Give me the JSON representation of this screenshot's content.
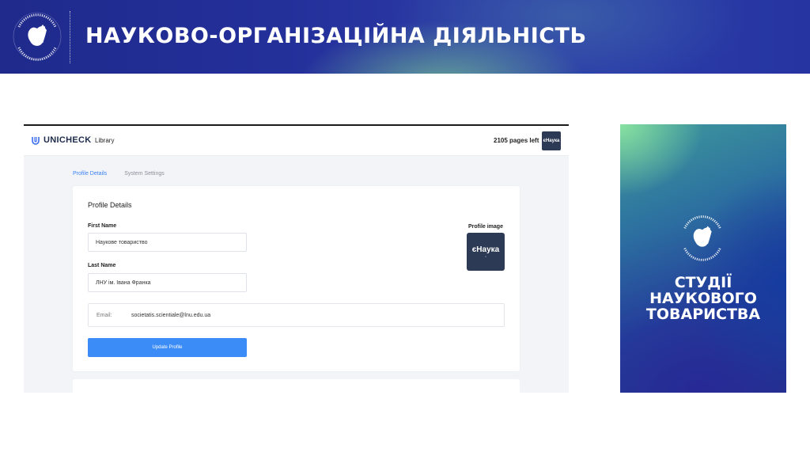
{
  "banner": {
    "title": "НАУКОВО-ОРГАНІЗАЦІЙНА ДІЯЛЬНІСТЬ",
    "logo_text": "UNIVERSITAS LEOPOLIENSIS SOCIETATIS SCIENTIALE"
  },
  "app": {
    "brand": "UNICHECK",
    "nav_library": "Library",
    "pages_left": "2105 pages left",
    "avatar_text": "єНаука"
  },
  "tabs": [
    {
      "label": "Profile Details",
      "active": true
    },
    {
      "label": "System Settings",
      "active": false
    }
  ],
  "profile": {
    "section_title": "Profile Details",
    "first_name_label": "First Name",
    "first_name_value": "Наукове товариство",
    "last_name_label": "Last Name",
    "last_name_value": "ЛНУ ім. Івана Франка",
    "email_label": "Email:",
    "email_value": "societatis.scientiale@lnu.edu.ua",
    "update_button": "Update Profile",
    "image_label": "Profile image",
    "image_text": "єНаука"
  },
  "poster": {
    "line1": "СТУДІЇ",
    "line2": "НАУКОВОГО",
    "line3": "ТОВАРИСТВА"
  },
  "colors": {
    "banner": "#24309a",
    "accent_blue": "#3b8cf6",
    "avatar_bg": "#2c3a55"
  }
}
